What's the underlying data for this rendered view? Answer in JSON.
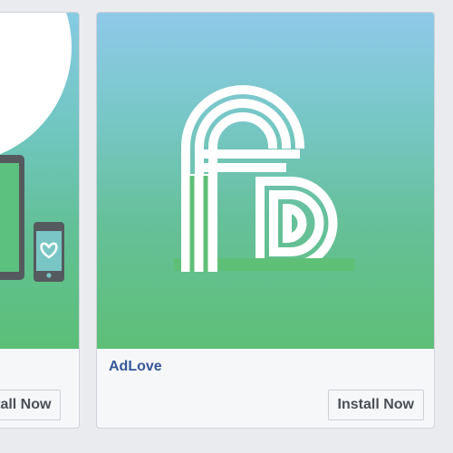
{
  "cards": [
    {
      "app_name": "",
      "install_label": "Install Now",
      "brand_color": "#5ebf77"
    },
    {
      "app_name": "AdLove",
      "install_label": "Install Now",
      "brand_color": "#5ebf77",
      "logo_icon": "adlove-logo-icon"
    }
  ],
  "colors": {
    "page_background": "#e9ebee",
    "app_name": "#365899",
    "button_text": "#4b4f56"
  }
}
